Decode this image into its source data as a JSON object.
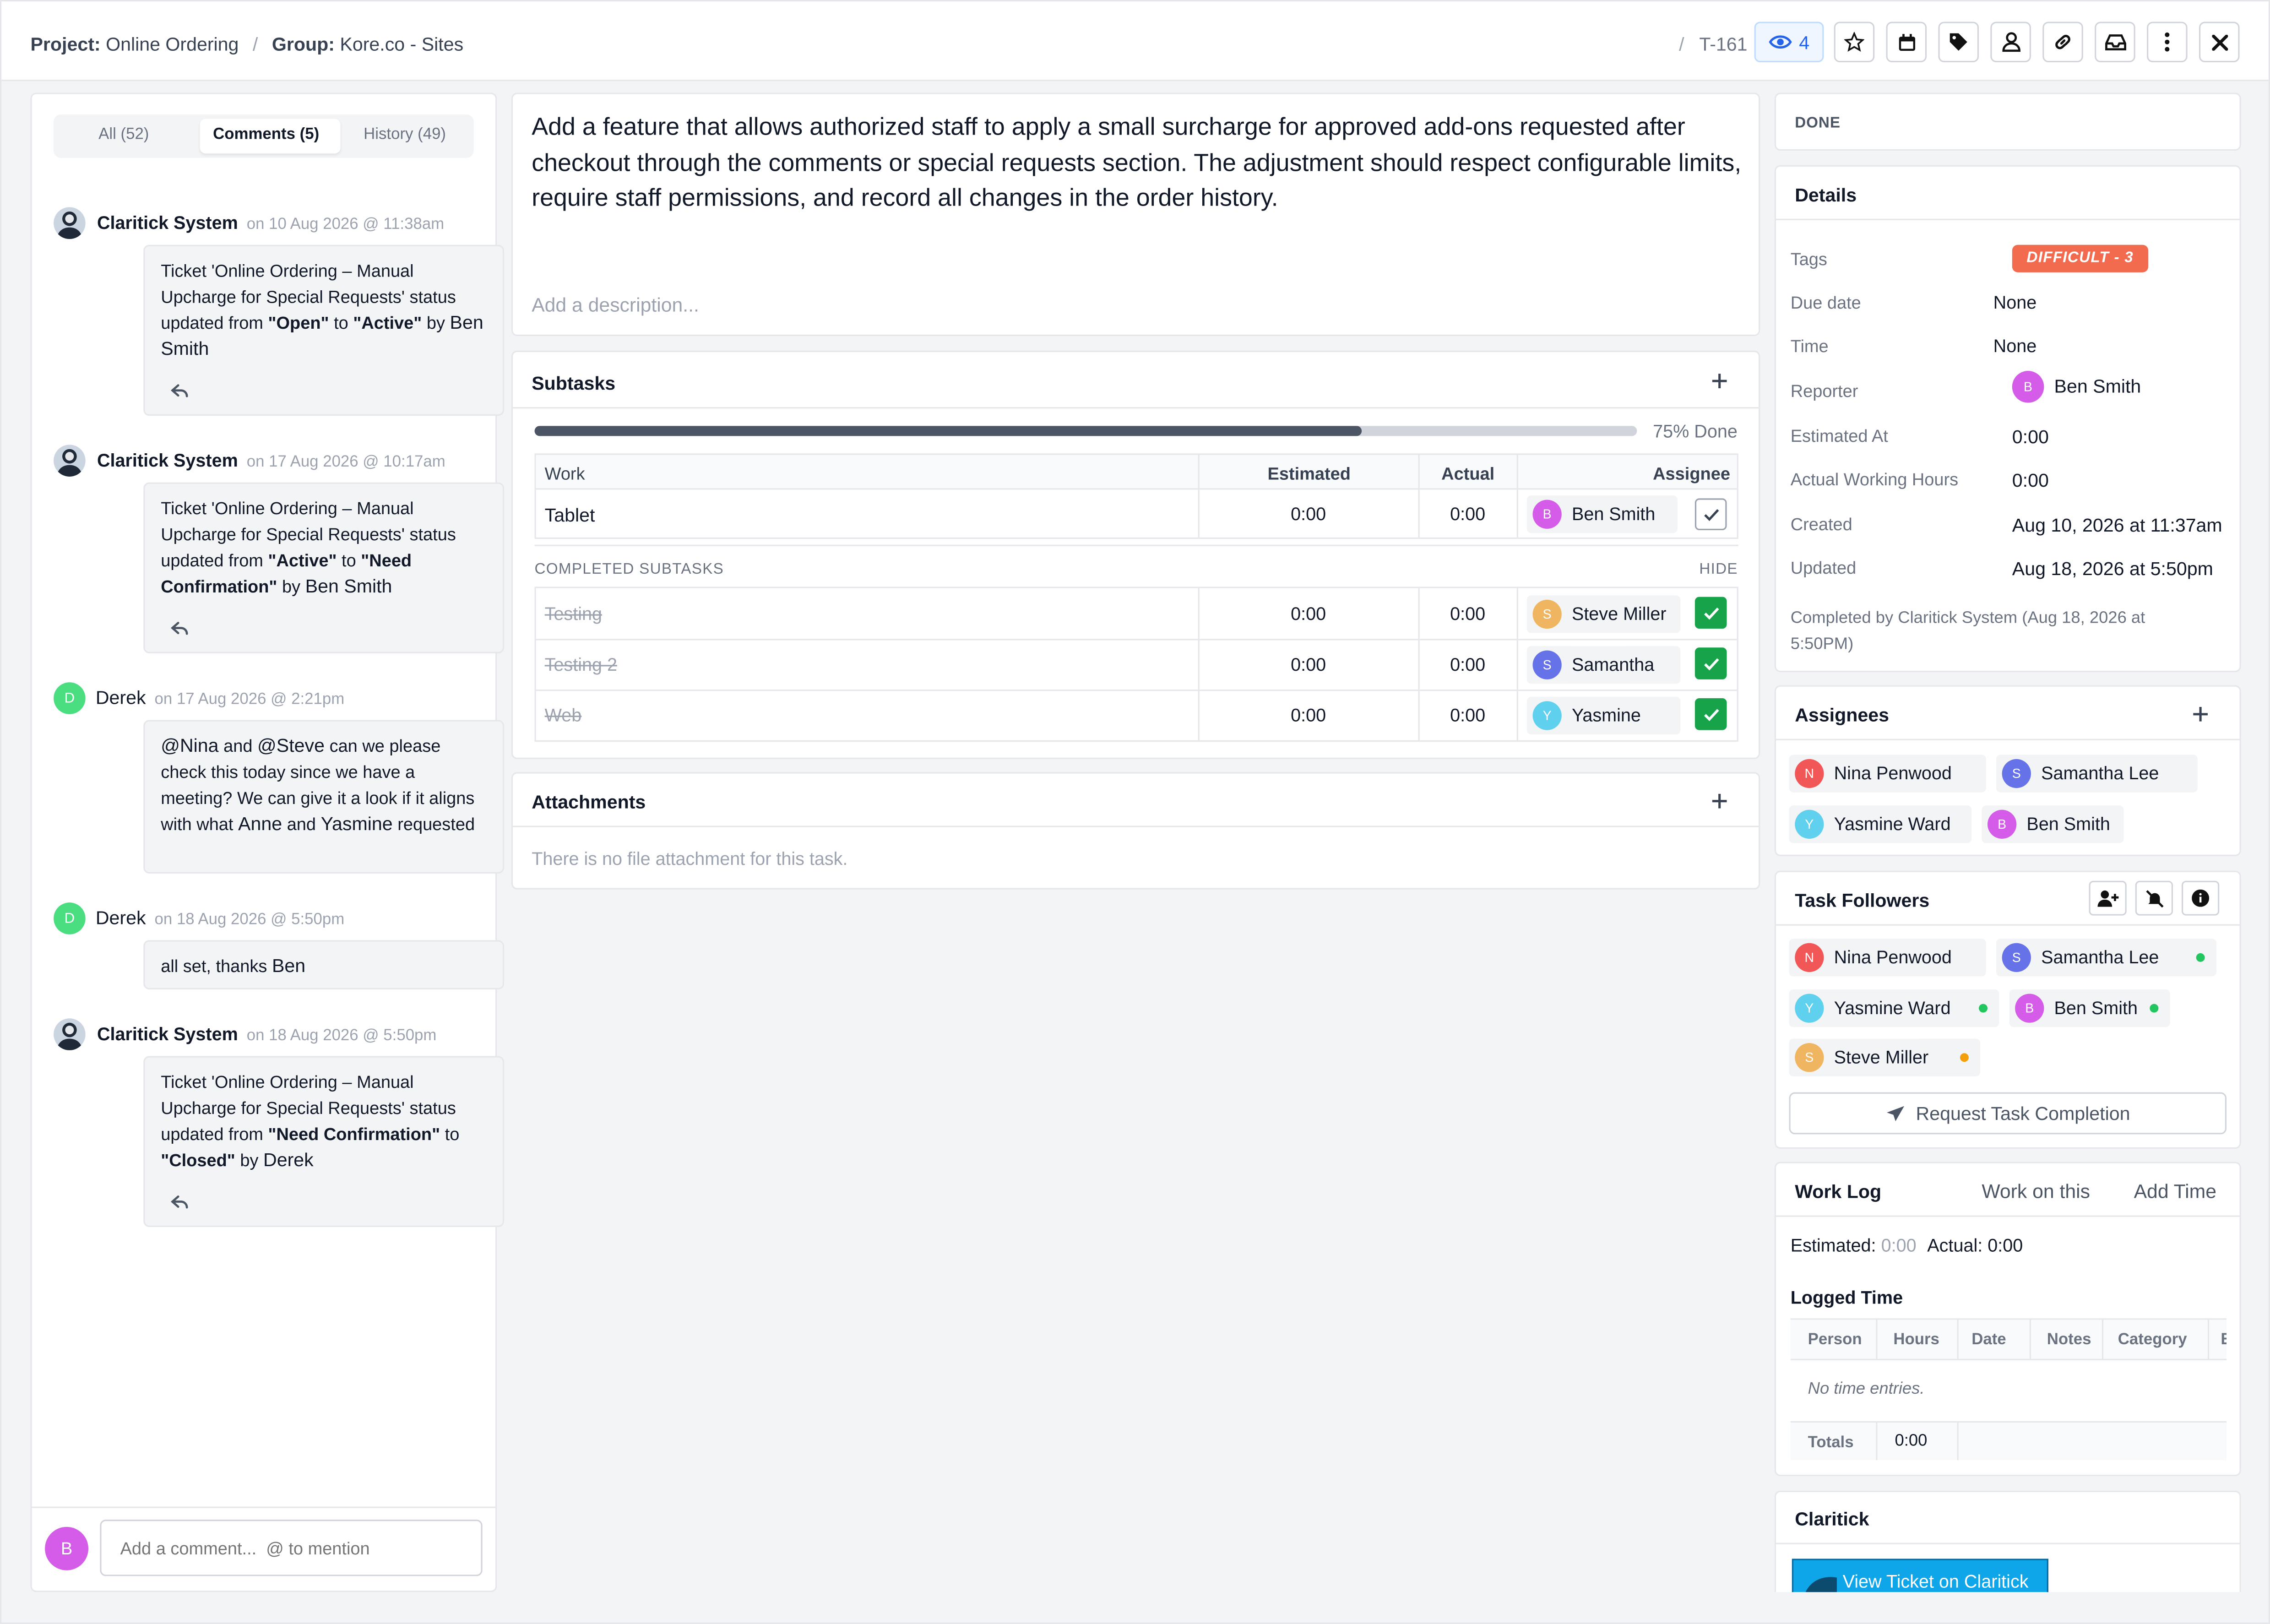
{
  "header": {
    "project_label": "Project:",
    "project_value": "Online Ordering",
    "group_label": "Group:",
    "group_value": "Kore.co - Sites",
    "ticket_id": "T-161",
    "watchers": "4"
  },
  "tabs": {
    "all": "All (52)",
    "comments": "Comments (5)",
    "history": "History (49)"
  },
  "comments": [
    {
      "author": "Claritick System",
      "date": "on 10 Aug 2026 @ 11:38am",
      "p1": "Ticket 'Online Ordering – Manual Upcharge for Special Requests' status updated from ",
      "b1": "\"Open\"",
      "p2": " to ",
      "b2": "\"Active\"",
      "p3": " by ",
      "who": "Ben Smith"
    },
    {
      "author": "Claritick System",
      "date": "on 17 Aug 2026 @ 10:17am",
      "p1": "Ticket 'Online Ordering – Manual Upcharge for Special Requests' status updated from ",
      "b1": "\"Active\"",
      "p2": " to ",
      "b2": "\"Need Confirmation\"",
      "p3": " by ",
      "who": "Ben Smith"
    },
    {
      "author": "Derek",
      "date": "on 17 Aug 2026 @ 2:21pm",
      "m1": "@Nina",
      "t1": " and ",
      "m2": "@Steve",
      "t2": " can we please check this today since we have a meeting? We can give it a look if it aligns with what ",
      "m3": "Anne",
      "t3": " and ",
      "m4": "Yasmine",
      "t4": " requested"
    },
    {
      "author": "Derek",
      "date": "on 18 Aug 2026 @ 5:50pm",
      "t1": "all set, thanks ",
      "m1": "Ben"
    },
    {
      "author": "Claritick System",
      "date": "on 18 Aug 2026 @ 5:50pm",
      "p1": "Ticket 'Online Ordering – Manual Upcharge for Special Requests' status updated from ",
      "b1": "\"Need Confirmation\"",
      "p2": " to ",
      "b2": "\"Closed\"",
      "p3": " by ",
      "who": "Derek"
    }
  ],
  "comment_input": {
    "placeholder": "Add a comment...  @ to mention",
    "avatar": "B"
  },
  "task": {
    "title": "Add a feature that allows authorized staff to apply a small surcharge for approved add-ons requested after checkout through the comments or special requests section. The adjustment should respect configurable limits, require staff permissions, and record all changes in the order history.",
    "description_placeholder": "Add a description..."
  },
  "subtasks": {
    "heading": "Subtasks",
    "progress_text": "75% Done",
    "progress": 0.75,
    "columns": {
      "work": "Work",
      "estimated": "Estimated",
      "actual": "Actual",
      "assignee": "Assignee"
    },
    "open": [
      {
        "work": "Tablet",
        "estimated": "0:00",
        "actual": "0:00",
        "assignee": "Ben Smith",
        "initial": "B"
      }
    ],
    "completed_label": "COMPLETED SUBTASKS",
    "hide_label": "HIDE",
    "completed": [
      {
        "work": "Testing",
        "estimated": "0:00",
        "actual": "0:00",
        "assignee": "Steve Miller",
        "initial": "S"
      },
      {
        "work": "Testing 2",
        "estimated": "0:00",
        "actual": "0:00",
        "assignee": "Samantha",
        "initial": "S"
      },
      {
        "work": "Web",
        "estimated": "0:00",
        "actual": "0:00",
        "assignee": "Yasmine",
        "initial": "Y"
      }
    ]
  },
  "attachments": {
    "heading": "Attachments",
    "empty": "There is no file attachment for this task."
  },
  "status": "DONE",
  "details": {
    "heading": "Details",
    "tags_label": "Tags",
    "tag": "DIFFICULT - 3",
    "due_label": "Due date",
    "due": "None",
    "time_label": "Time",
    "time": "None",
    "reporter_label": "Reporter",
    "reporter": "Ben Smith",
    "reporter_initial": "B",
    "estimated_label": "Estimated At",
    "estimated": "0:00",
    "actual_label": "Actual Working Hours",
    "actual": "0:00",
    "created_label": "Created",
    "created": "Aug 10, 2026 at 11:37am",
    "updated_label": "Updated",
    "updated": "Aug 18, 2026 at 5:50pm",
    "completed_by": "Completed by Claritick System (Aug 18, 2026 at 5:50PM)"
  },
  "assignees": {
    "heading": "Assignees",
    "people": [
      {
        "name": "Nina Penwood",
        "initial": "N"
      },
      {
        "name": "Samantha Lee",
        "initial": "S"
      },
      {
        "name": "Yasmine Ward",
        "initial": "Y"
      },
      {
        "name": "Ben Smith",
        "initial": "B"
      }
    ]
  },
  "followers": {
    "heading": "Task Followers",
    "people": [
      {
        "name": "Nina Penwood",
        "initial": "N"
      },
      {
        "name": "Samantha Lee",
        "initial": "S"
      },
      {
        "name": "Yasmine Ward",
        "initial": "Y"
      },
      {
        "name": "Ben Smith",
        "initial": "B"
      },
      {
        "name": "Steve Miller",
        "initial": "S"
      }
    ],
    "request_button": "Request Task Completion"
  },
  "worklog": {
    "heading": "Work Log",
    "work_on_this": "Work on this",
    "add_time": "Add Time",
    "estimated_label": "Estimated:",
    "estimated": "0:00",
    "actual_label": "Actual:",
    "actual": "0:00",
    "logged_heading": "Logged Time",
    "columns": {
      "person": "Person",
      "hours": "Hours",
      "date": "Date",
      "notes": "Notes",
      "category": "Category",
      "extra": "E"
    },
    "empty": "No time entries.",
    "totals_label": "Totals",
    "totals": "0:00"
  },
  "claritick": {
    "heading": "Claritick",
    "button": "View Ticket on Claritick"
  },
  "colors": {
    "accent": "#2563eb",
    "tag": "#f26b4f",
    "success": "#16a34a",
    "claritick": "#0ea5e9",
    "avatar_b": "#d45ce8",
    "avatar_s_blue": "#6673e8",
    "avatar_s_orange": "#f0b560",
    "avatar_y": "#5fd1ee",
    "avatar_n": "#f25757",
    "avatar_d": "#4ade80"
  }
}
